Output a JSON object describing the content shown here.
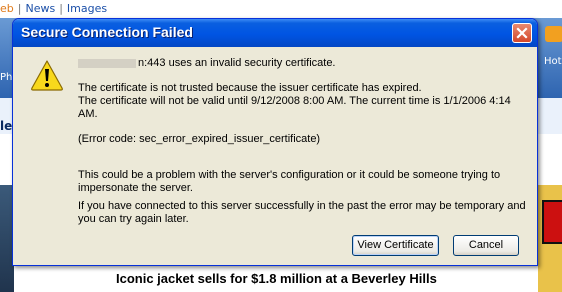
{
  "background_page": {
    "top_links": [
      "eb",
      "News",
      "Images"
    ],
    "left_fragments": [
      "Phil",
      "le"
    ],
    "right_fragment": "Hot",
    "headline": "Iconic jacket sells for $1.8 million at a Beverley Hills"
  },
  "dialog": {
    "title": "Secure Connection Failed",
    "close_icon": "close-icon",
    "warning_icon": "warning-icon",
    "host_suffix": "n:443 uses an invalid security certificate.",
    "line_2": "The certificate is not trusted because the issuer certificate has expired.",
    "line_3": "The certificate will not be valid until 9/12/2008 8:00 AM. The current time is 1/1/2006 4:14 AM.",
    "line_4": "(Error code: sec_error_expired_issuer_certificate)",
    "line_5": "This could be a problem with the server's configuration or it could be someone trying to impersonate the server.",
    "line_6": "If you have connected to this server successfully in the past the error may be temporary and you can try again later.",
    "buttons": {
      "view_certificate": "View Certificate",
      "cancel": "Cancel"
    },
    "colors": {
      "titlebar": "#0054e3",
      "face": "#ece9d8",
      "close": "#d4472a"
    }
  }
}
